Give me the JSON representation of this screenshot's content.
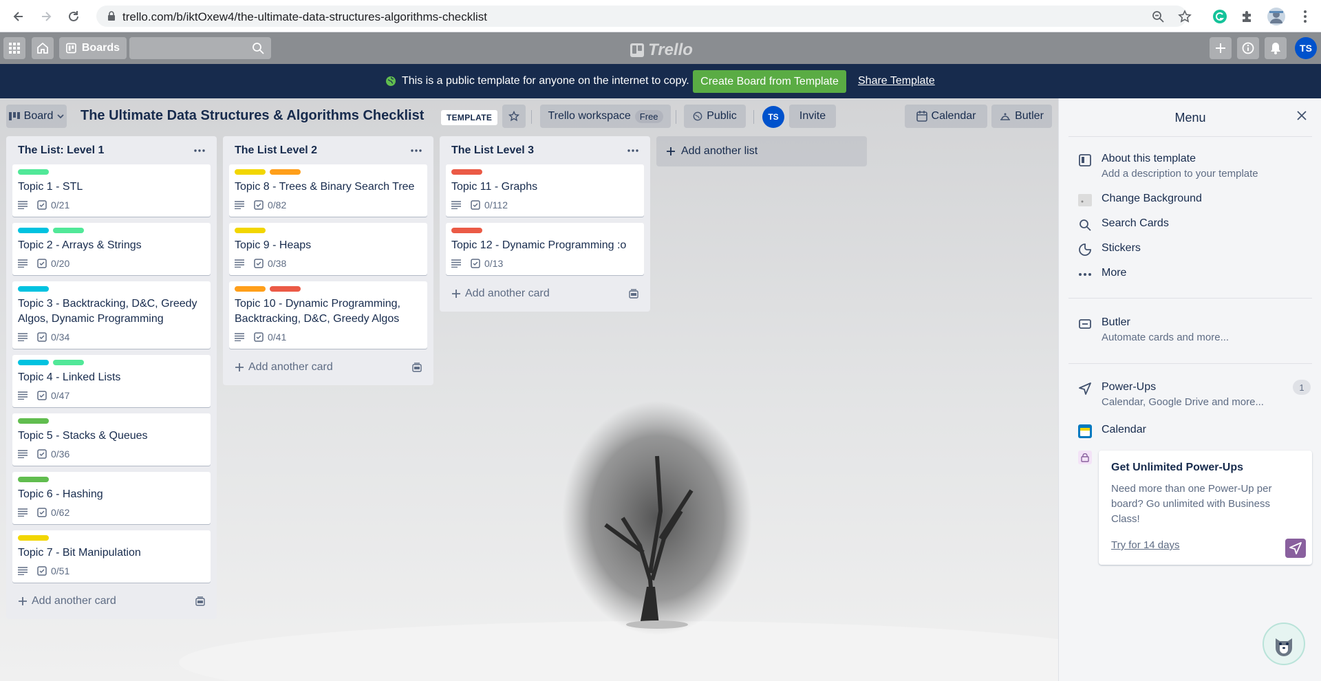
{
  "browser": {
    "url": "trello.com/b/iktOxew4/the-ultimate-data-structures-algorithms-checklist"
  },
  "header": {
    "boards_label": "Boards",
    "logo_text": "Trello",
    "avatar_initials": "TS"
  },
  "banner": {
    "message": "This is a public template for anyone on the internet to copy.",
    "create_label": "Create Board from Template",
    "share_label": "Share Template"
  },
  "board": {
    "view_label": "Board",
    "title": "The Ultimate Data Structures & Algorithms Checklist",
    "template_badge": "TEMPLATE",
    "workspace_label": "Trello workspace",
    "workspace_plan": "Free",
    "visibility_label": "Public",
    "member_initials": "TS",
    "invite_label": "Invite",
    "calendar_label": "Calendar",
    "butler_label": "Butler",
    "add_list_label": "Add another list"
  },
  "colors": {
    "green": "#61bd4f",
    "mint": "#51e898",
    "sky": "#00c2e0",
    "yellow": "#f2d600",
    "orange": "#ff9f1a",
    "red": "#eb5a46"
  },
  "lists": [
    {
      "title": "The List: Level 1",
      "add_card_label": "Add another card",
      "cards": [
        {
          "title": "Topic 1 - STL",
          "labels": [
            "mint"
          ],
          "checklist": "0/21"
        },
        {
          "title": "Topic 2 - Arrays & Strings",
          "labels": [
            "sky",
            "mint"
          ],
          "checklist": "0/20"
        },
        {
          "title": "Topic 3 - Backtracking, D&C, Greedy Algos, Dynamic Programming",
          "labels": [
            "sky"
          ],
          "checklist": "0/34"
        },
        {
          "title": "Topic 4 - Linked Lists",
          "labels": [
            "sky",
            "mint"
          ],
          "checklist": "0/47"
        },
        {
          "title": "Topic 5 - Stacks & Queues",
          "labels": [
            "green"
          ],
          "checklist": "0/36"
        },
        {
          "title": "Topic 6 - Hashing",
          "labels": [
            "green"
          ],
          "checklist": "0/62"
        },
        {
          "title": "Topic 7 - Bit Manipulation",
          "labels": [
            "yellow"
          ],
          "checklist": "0/51"
        }
      ]
    },
    {
      "title": "The List Level 2",
      "add_card_label": "Add another card",
      "cards": [
        {
          "title": "Topic 8 - Trees & Binary Search Tree",
          "labels": [
            "yellow",
            "orange"
          ],
          "checklist": "0/82"
        },
        {
          "title": "Topic 9 - Heaps",
          "labels": [
            "yellow"
          ],
          "checklist": "0/38"
        },
        {
          "title": "Topic 10 - Dynamic Programming, Backtracking, D&C, Greedy Algos",
          "labels": [
            "orange",
            "red"
          ],
          "checklist": "0/41"
        }
      ]
    },
    {
      "title": "The List Level 3",
      "add_card_label": "Add another card",
      "cards": [
        {
          "title": "Topic 11 - Graphs",
          "labels": [
            "red"
          ],
          "checklist": "0/112"
        },
        {
          "title": "Topic 12 - Dynamic Programming :o",
          "labels": [
            "red"
          ],
          "checklist": "0/13"
        }
      ]
    }
  ],
  "menu": {
    "title": "Menu",
    "about_title": "About this template",
    "about_sub": "Add a description to your template",
    "change_background": "Change Background",
    "search_cards": "Search Cards",
    "stickers": "Stickers",
    "more": "More",
    "butler_title": "Butler",
    "butler_sub": "Automate cards and more...",
    "powerups_title": "Power-Ups",
    "powerups_count": "1",
    "powerups_sub": "Calendar, Google Drive and more...",
    "calendar": "Calendar",
    "upsell_title": "Get Unlimited Power-Ups",
    "upsell_body": "Need more than one Power-Up per board? Go unlimited with Business Class!",
    "upsell_link": "Try for 14 days"
  }
}
